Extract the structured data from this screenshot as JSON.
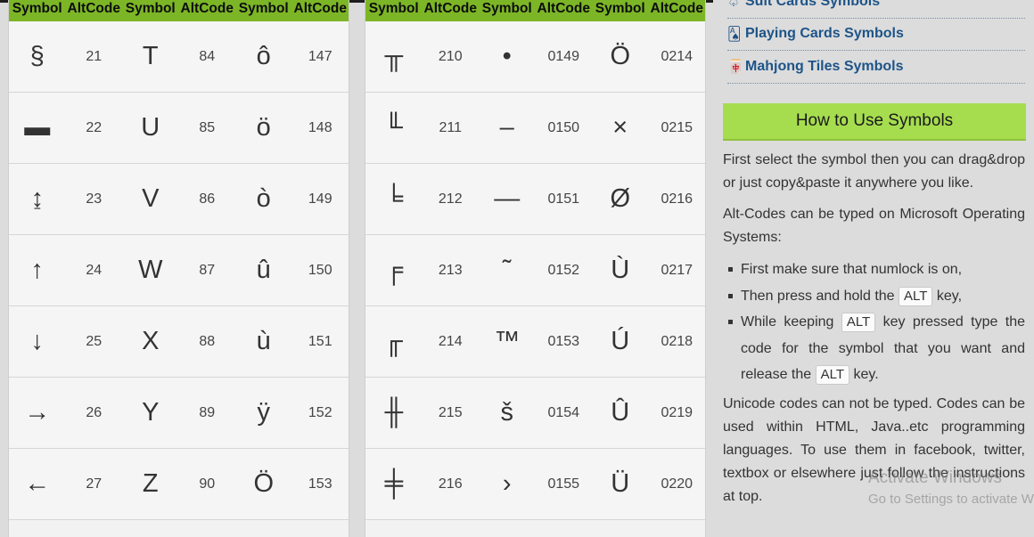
{
  "table_header": [
    "Symbol",
    "AltCode",
    "Symbol",
    "AltCode",
    "Symbol",
    "AltCode"
  ],
  "tables": [
    {
      "rows": [
        [
          "§",
          "21",
          "T",
          "84",
          "ô",
          "147"
        ],
        [
          "▬",
          "22",
          "U",
          "85",
          "ö",
          "148"
        ],
        [
          "↨",
          "23",
          "V",
          "86",
          "ò",
          "149"
        ],
        [
          "↑",
          "24",
          "W",
          "87",
          "û",
          "150"
        ],
        [
          "↓",
          "25",
          "X",
          "88",
          "ù",
          "151"
        ],
        [
          "→",
          "26",
          "Y",
          "89",
          "ÿ",
          "152"
        ],
        [
          "←",
          "27",
          "Z",
          "90",
          "Ö",
          "153"
        ]
      ]
    },
    {
      "rows": [
        [
          "╥",
          "210",
          "•",
          "0149",
          "Ö",
          "0214"
        ],
        [
          "╙",
          "211",
          "–",
          "0150",
          "×",
          "0215"
        ],
        [
          "╘",
          "212",
          "—",
          "0151",
          "Ø",
          "0216"
        ],
        [
          "╒",
          "213",
          "˜",
          "0152",
          "Ù",
          "0217"
        ],
        [
          "╓",
          "214",
          "™",
          "0153",
          "Ú",
          "0218"
        ],
        [
          "╫",
          "215",
          "š",
          "0154",
          "Û",
          "0219"
        ],
        [
          "╪",
          "216",
          "›",
          "0155",
          "Ü",
          "0220"
        ]
      ]
    }
  ],
  "sidebar": {
    "menu": [
      {
        "icon": "♤",
        "label": "Suit Cards Symbols",
        "icon_name": "spade-icon"
      },
      {
        "icon": "🂡",
        "label": "Playing Cards Symbols",
        "icon_name": "playing-card-icon"
      },
      {
        "icon": "🀄",
        "label": "Mahjong Tiles Symbols",
        "icon_name": "mahjong-tile-icon"
      }
    ],
    "howto_title": "How to Use Symbols",
    "p1": "First select the symbol then you can drag&drop or just copy&paste it anywhere you like.",
    "p2": "Alt-Codes can be typed on Microsoft Operating Systems:",
    "steps": {
      "s1": "First make sure that numlock is on,",
      "s2_pre": "Then press and hold the",
      "s2_post": "key,",
      "s3_pre": "While keeping",
      "s3_mid": "key pressed type the code for the symbol that you want and release the",
      "s3_post": "key."
    },
    "alt_key": "ALT",
    "p3": "Unicode codes can not be typed. Codes can be used within HTML, Java..etc programming languages. To use them in facebook, twitter, textbox or elsewhere just follow the instructions at top."
  },
  "watermark": {
    "line1": "Activate Windows",
    "line2": "Go to Settings to activate Windows."
  },
  "colors": {
    "header_green": "#7cb626",
    "howto_green": "#a6dd4f",
    "link_blue": "#1d5488"
  }
}
